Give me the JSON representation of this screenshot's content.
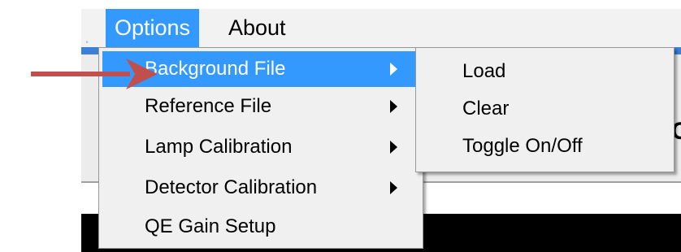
{
  "menubar": {
    "items": [
      {
        "label": "Options",
        "active": true
      },
      {
        "label": "About",
        "active": false
      }
    ]
  },
  "dropdown": {
    "items": [
      {
        "label": "Background File",
        "has_submenu": true,
        "highlighted": true
      },
      {
        "label": "Reference File",
        "has_submenu": true,
        "highlighted": false
      },
      {
        "label": "Lamp Calibration",
        "has_submenu": true,
        "highlighted": false
      },
      {
        "label": "Detector Calibration",
        "has_submenu": true,
        "highlighted": false
      },
      {
        "label": "QE Gain Setup",
        "has_submenu": false,
        "highlighted": false
      }
    ]
  },
  "submenu": {
    "items": [
      {
        "label": "Load"
      },
      {
        "label": "Clear"
      },
      {
        "label": "Toggle On/Off"
      }
    ]
  },
  "annotation": {
    "icon": "right-arrow-icon",
    "color": "#c0504d"
  },
  "colors": {
    "highlight": "#3399ff",
    "menu_background": "#f0f0f0",
    "title_band": "#3c7fd6"
  }
}
